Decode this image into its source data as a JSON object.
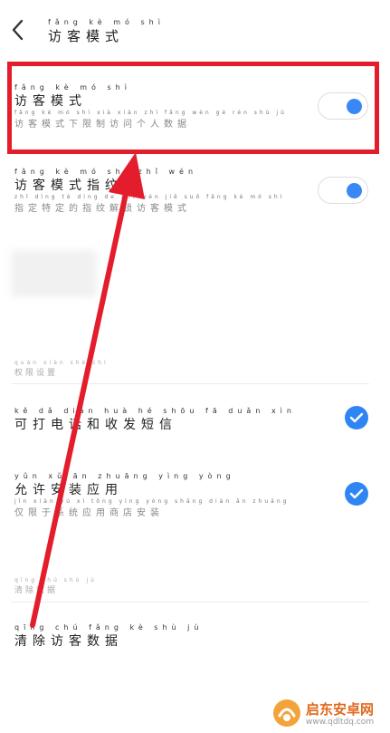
{
  "header": {
    "title_pinyin": "fǎng kè mó shì",
    "title": "访客模式"
  },
  "visitor_mode": {
    "label_pinyin": "fǎng kè mó shì",
    "label": "访客模式",
    "desc_pinyin": "fǎng kè mó shì xià xiàn zhì fǎng wèn gè rén shù jù",
    "desc": "访客模式下限制访问个人数据",
    "enabled": true
  },
  "fingerprint": {
    "label_pinyin": "fǎng kè mó shì zhǐ wén",
    "label": "访客模式指纹",
    "desc_pinyin": "zhǐ dìng tè dìng de zhǐ wén jiě suǒ fǎng kè mó shì",
    "desc": "指定特定的指纹解锁访客模式",
    "enabled": true
  },
  "permissions": {
    "section_pinyin": "quán xiàn shè zhì",
    "section": "权限设置",
    "items": [
      {
        "label_pinyin": "kě dǎ diàn huà hé shōu fā duǎn xìn",
        "label": "可打电话和收发短信",
        "checked": true
      },
      {
        "label_pinyin": "yǔn xǔ ān zhuāng yìng yòng",
        "label": "允许安装应用",
        "desc_pinyin": "jǐn xiàn yú xì tǒng yìng yòng shāng diàn ān zhuāng",
        "desc": "仅限于系统应用商店安装",
        "checked": true
      }
    ]
  },
  "clear": {
    "section_pinyin": "qīng chú shù jù",
    "section": "清除数据",
    "action_pinyin": "qīng chú fǎng kè shù jù",
    "action": "清除访客数据"
  },
  "watermark": {
    "brand": "启东安卓网",
    "url": "www.qdltdq.com"
  },
  "colors": {
    "accent": "#2f86f2",
    "annotation": "#e41d2c"
  }
}
